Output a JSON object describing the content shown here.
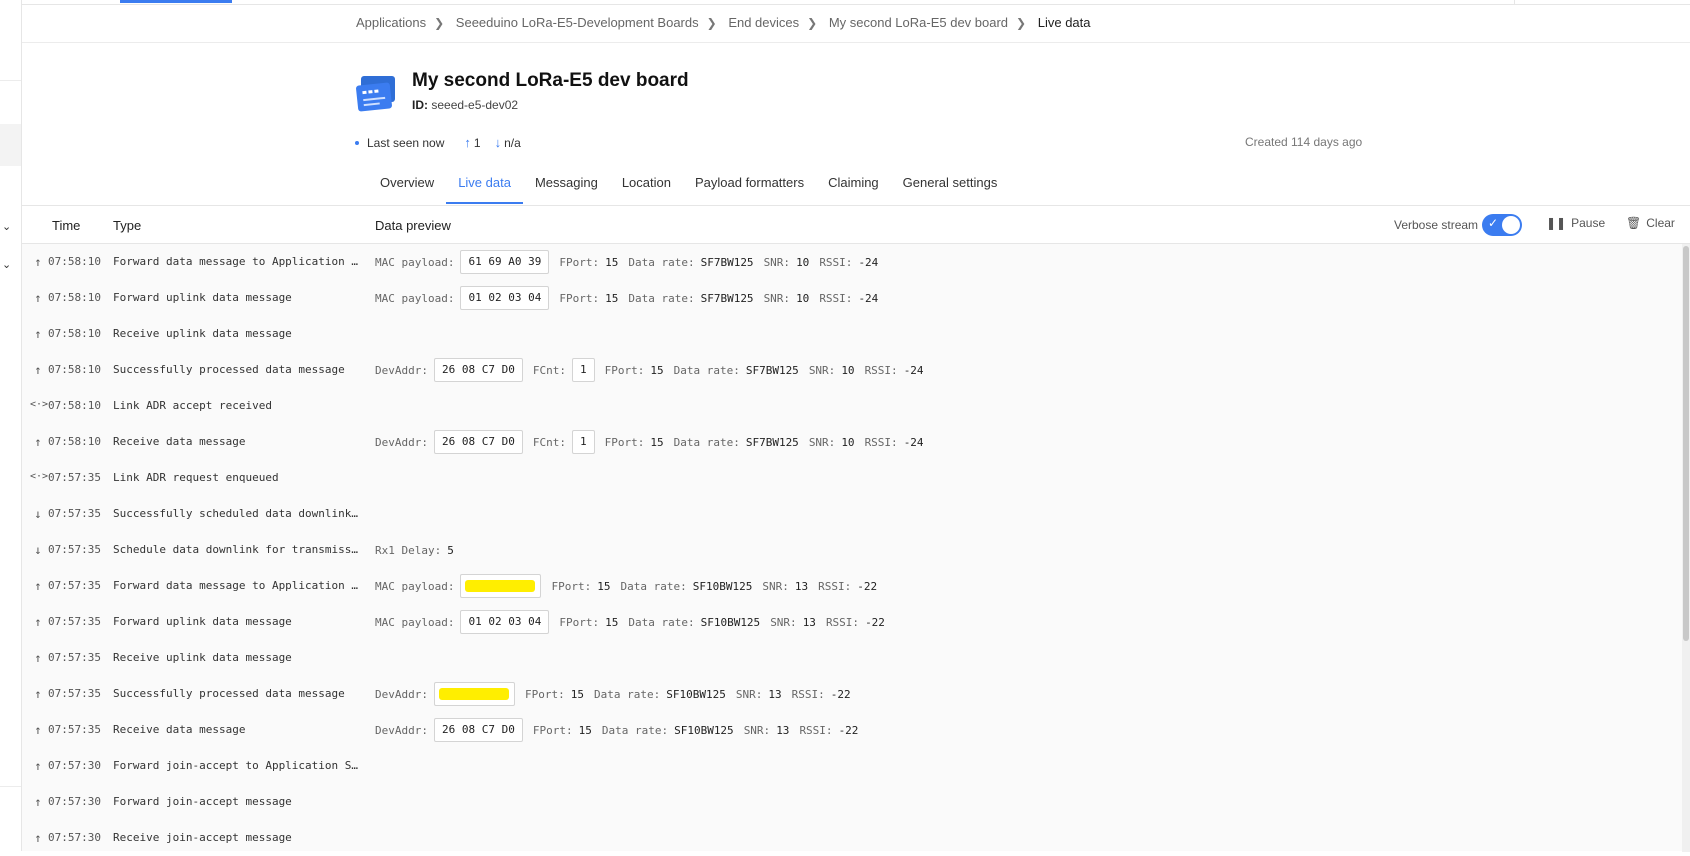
{
  "breadcrumb": {
    "items": [
      "Applications",
      "Seeeduino LoRa-E5-Development Boards",
      "End devices",
      "My second LoRa-E5 dev board"
    ],
    "current": "Live data"
  },
  "device": {
    "name": "My second LoRa-E5 dev board",
    "id_label": "ID:",
    "id_value": "seeed-e5-dev02",
    "last_seen": "Last seen now",
    "uplink_count": "1",
    "downlink_count": "n/a",
    "created": "Created 114 days ago"
  },
  "tabs": [
    "Overview",
    "Live data",
    "Messaging",
    "Location",
    "Payload formatters",
    "Claiming",
    "General settings"
  ],
  "active_tab": "Live data",
  "table": {
    "headers": {
      "time": "Time",
      "type": "Type",
      "preview": "Data preview"
    },
    "verbose_label": "Verbose stream",
    "verbose_on": true,
    "pause_label": "Pause",
    "clear_label": "Clear"
  },
  "colors": {
    "accent": "#3b7cf0",
    "redaction": "#ffee00"
  },
  "rows": [
    {
      "dir": "up",
      "time": "07:58:10",
      "type": "Forward data message to Application Server",
      "preview": [
        {
          "k": "MAC payload:",
          "box": "61 69 A0 39"
        },
        {
          "k": "FPort:",
          "v": "15"
        },
        {
          "k": "Data rate:",
          "v": "SF7BW125"
        },
        {
          "k": "SNR:",
          "v": "10"
        },
        {
          "k": "RSSI:",
          "v": "-24"
        }
      ]
    },
    {
      "dir": "up",
      "time": "07:58:10",
      "type": "Forward uplink data message",
      "preview": [
        {
          "k": "MAC payload:",
          "box": "01 02 03 04"
        },
        {
          "k": "FPort:",
          "v": "15"
        },
        {
          "k": "Data rate:",
          "v": "SF7BW125"
        },
        {
          "k": "SNR:",
          "v": "10"
        },
        {
          "k": "RSSI:",
          "v": "-24"
        }
      ]
    },
    {
      "dir": "up",
      "time": "07:58:10",
      "type": "Receive uplink data message",
      "preview": []
    },
    {
      "dir": "up",
      "time": "07:58:10",
      "type": "Successfully processed data message",
      "preview": [
        {
          "k": "DevAddr:",
          "box": "26 08 C7 D0"
        },
        {
          "k": "FCnt:",
          "box": "1"
        },
        {
          "k": "FPort:",
          "v": "15"
        },
        {
          "k": "Data rate:",
          "v": "SF7BW125"
        },
        {
          "k": "SNR:",
          "v": "10"
        },
        {
          "k": "RSSI:",
          "v": "-24"
        }
      ]
    },
    {
      "dir": "both",
      "time": "07:58:10",
      "type": "Link ADR accept received",
      "preview": []
    },
    {
      "dir": "up",
      "time": "07:58:10",
      "type": "Receive data message",
      "preview": [
        {
          "k": "DevAddr:",
          "box": "26 08 C7 D0"
        },
        {
          "k": "FCnt:",
          "box": "1"
        },
        {
          "k": "FPort:",
          "v": "15"
        },
        {
          "k": "Data rate:",
          "v": "SF7BW125"
        },
        {
          "k": "SNR:",
          "v": "10"
        },
        {
          "k": "RSSI:",
          "v": "-24"
        }
      ]
    },
    {
      "dir": "both",
      "time": "07:57:35",
      "type": "Link ADR request enqueued",
      "preview": []
    },
    {
      "dir": "down",
      "time": "07:57:35",
      "type": "Successfully scheduled data downlink for transmission",
      "preview": []
    },
    {
      "dir": "down",
      "time": "07:57:35",
      "type": "Schedule data downlink for transmission on Gateway Server",
      "preview": [
        {
          "k": "Rx1 Delay:",
          "v": "5"
        }
      ]
    },
    {
      "dir": "up",
      "time": "07:57:35",
      "type": "Forward data message to Application Server",
      "preview": [
        {
          "k": "MAC payload:",
          "redact": true
        },
        {
          "k": "FPort:",
          "v": "15"
        },
        {
          "k": "Data rate:",
          "v": "SF10BW125"
        },
        {
          "k": "SNR:",
          "v": "13"
        },
        {
          "k": "RSSI:",
          "v": "-22"
        }
      ]
    },
    {
      "dir": "up",
      "time": "07:57:35",
      "type": "Forward uplink data message",
      "preview": [
        {
          "k": "MAC payload:",
          "box": "01 02 03 04"
        },
        {
          "k": "FPort:",
          "v": "15"
        },
        {
          "k": "Data rate:",
          "v": "SF10BW125"
        },
        {
          "k": "SNR:",
          "v": "13"
        },
        {
          "k": "RSSI:",
          "v": "-22"
        }
      ]
    },
    {
      "dir": "up",
      "time": "07:57:35",
      "type": "Receive uplink data message",
      "preview": []
    },
    {
      "dir": "up",
      "time": "07:57:35",
      "type": "Successfully processed data message",
      "preview": [
        {
          "k": "DevAddr:",
          "redact": true
        },
        {
          "k": "FPort:",
          "v": "15"
        },
        {
          "k": "Data rate:",
          "v": "SF10BW125"
        },
        {
          "k": "SNR:",
          "v": "13"
        },
        {
          "k": "RSSI:",
          "v": "-22"
        }
      ]
    },
    {
      "dir": "up",
      "time": "07:57:35",
      "type": "Receive data message",
      "preview": [
        {
          "k": "DevAddr:",
          "box": "26 08 C7 D0"
        },
        {
          "k": "FPort:",
          "v": "15"
        },
        {
          "k": "Data rate:",
          "v": "SF10BW125"
        },
        {
          "k": "SNR:",
          "v": "13"
        },
        {
          "k": "RSSI:",
          "v": "-22"
        }
      ]
    },
    {
      "dir": "up",
      "time": "07:57:30",
      "type": "Forward join-accept to Application Server",
      "preview": []
    },
    {
      "dir": "up",
      "time": "07:57:30",
      "type": "Forward join-accept message",
      "preview": []
    },
    {
      "dir": "up",
      "time": "07:57:30",
      "type": "Receive join-accept message",
      "preview": []
    }
  ]
}
